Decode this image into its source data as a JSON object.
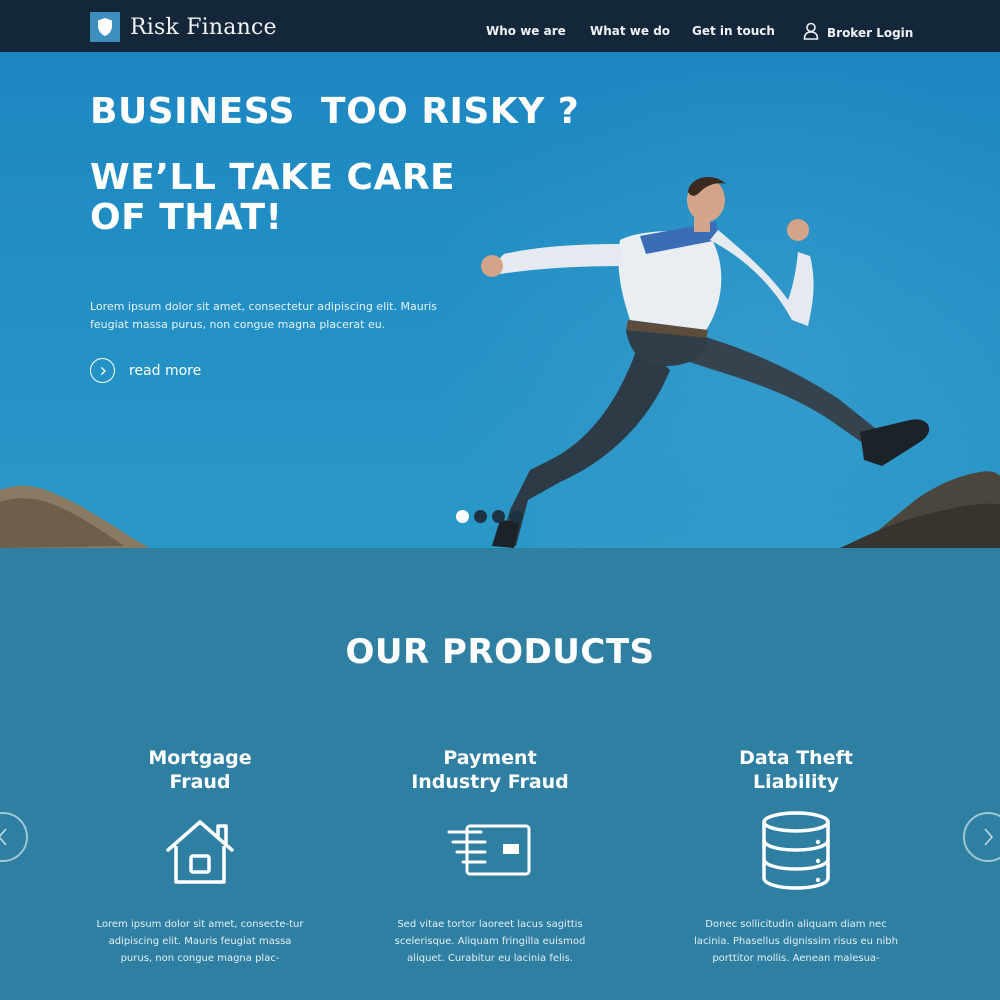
{
  "header": {
    "brand": "Risk Finance",
    "nav": [
      {
        "label": "Who we are"
      },
      {
        "label": "What we do"
      },
      {
        "label": "Get in touch"
      }
    ],
    "broker_login": "Broker Login"
  },
  "hero": {
    "headline_1": "BUSINESS  TOO RISKY ?",
    "headline_2": "WE’LL TAKE CARE OF THAT!",
    "text": "Lorem ipsum dolor sit amet, consectetur adipiscing elit. Mauris feugiat massa purus, non congue magna placerat eu.",
    "read_more": "read more",
    "slides": 4,
    "active_slide": 1
  },
  "products": {
    "title": "OUR PRODUCTS",
    "items": [
      {
        "title_1": "Mortgage",
        "title_2": "Fraud",
        "icon": "house-icon",
        "text": "Lorem ipsum dolor sit amet, consecte-tur adipiscing elit. Mauris feugiat massa purus, non congue magna plac-"
      },
      {
        "title_1": "Payment",
        "title_2": "Industry Fraud",
        "icon": "credit-card-icon",
        "text": "Sed vitae tortor laoreet lacus sagittis scelerisque. Aliquam fringilla euismod aliquet. Curabitur eu lacinia felis."
      },
      {
        "title_1": "Data Theft",
        "title_2": "Liability",
        "icon": "database-icon",
        "text": "Donec sollicitudin aliquam diam nec lacinia. Phasellus dignissim risus eu nibh porttitor mollis. Aenean malesua-"
      }
    ]
  },
  "colors": {
    "header_bg": "#13263a",
    "hero_sky": "#218fc4",
    "products_bg": "#2f7fa2",
    "logo_accent": "#3d8fbf"
  }
}
